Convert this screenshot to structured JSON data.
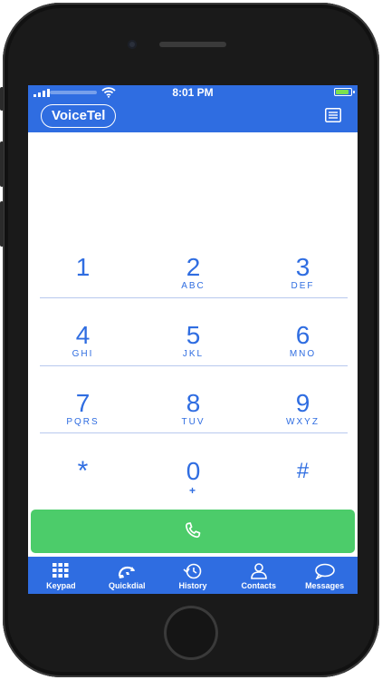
{
  "status_bar": {
    "time": "8:01 PM"
  },
  "header": {
    "brand": "VoiceTel",
    "menu_icon": "list-icon"
  },
  "keypad": {
    "rows": [
      [
        {
          "digit": "1",
          "letters": ""
        },
        {
          "digit": "2",
          "letters": "ABC"
        },
        {
          "digit": "3",
          "letters": "DEF"
        }
      ],
      [
        {
          "digit": "4",
          "letters": "GHI"
        },
        {
          "digit": "5",
          "letters": "JKL"
        },
        {
          "digit": "6",
          "letters": "MNO"
        }
      ],
      [
        {
          "digit": "7",
          "letters": "PQRS"
        },
        {
          "digit": "8",
          "letters": "TUV"
        },
        {
          "digit": "9",
          "letters": "WXYZ"
        }
      ],
      [
        {
          "digit": "*",
          "letters": ""
        },
        {
          "digit": "0",
          "letters": "+"
        },
        {
          "digit": "#",
          "letters": ""
        }
      ]
    ]
  },
  "call_button": {
    "icon": "phone-icon"
  },
  "tabs": [
    {
      "label": "Keypad",
      "icon": "keypad-icon"
    },
    {
      "label": "Quickdial",
      "icon": "quickdial-icon"
    },
    {
      "label": "History",
      "icon": "history-icon"
    },
    {
      "label": "Contacts",
      "icon": "contacts-icon"
    },
    {
      "label": "Messages",
      "icon": "messages-icon"
    }
  ],
  "colors": {
    "primary": "#2f6de1",
    "call": "#4ccc6a",
    "battery": "#7be14f"
  }
}
